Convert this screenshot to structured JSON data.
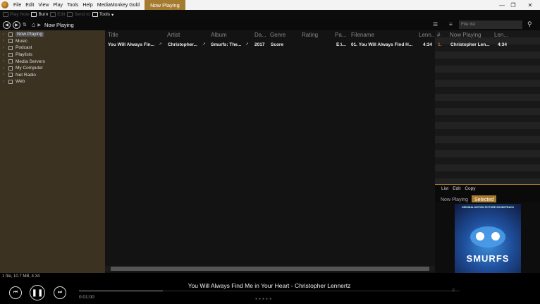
{
  "menu": [
    "File",
    "Edit",
    "View",
    "Play",
    "Tools",
    "Help",
    "MediaMonkey Gold"
  ],
  "tab_now_playing": "Now Playing",
  "toolbar": {
    "play_now": "Play Now",
    "burn": "Burn",
    "edit": "Edit",
    "send_to": "Send to",
    "tools": "Tools"
  },
  "nav": {
    "location": "Now Playing"
  },
  "file_list_placeholder": "File list",
  "tree": [
    {
      "label": "Now Playing",
      "active": true
    },
    {
      "label": "Music"
    },
    {
      "label": "Podcast"
    },
    {
      "label": "Playlists"
    },
    {
      "label": "Media Servers"
    },
    {
      "label": "My Computer"
    },
    {
      "label": "Net Radio"
    },
    {
      "label": "Web"
    }
  ],
  "columns": [
    "Title",
    "Artist",
    "Album",
    "Da...",
    "Genre",
    "Rating",
    "Pa...",
    "Filename",
    "Lenn..."
  ],
  "track": {
    "title": "You Will Always Fin...",
    "artist": "Christopher...",
    "album": "Smurfs: The...",
    "date": "2017",
    "genre": "Score",
    "path": "E:\\...",
    "filename": "01. You Will Always Find H...",
    "length": "4:34"
  },
  "right_panel": {
    "columns": [
      "#",
      "Now Playing",
      "Len..."
    ],
    "row": {
      "num": "1.",
      "artist": "Christopher Len...",
      "length": "4:34"
    },
    "list_menu": [
      "List",
      "Edit",
      "Copy"
    ],
    "tabs": [
      "Now Playing",
      "Selected"
    ],
    "art_caption": "ORIGINAL MOTION PICTURE SOUNDTRACK",
    "art_logo": "SMURFS"
  },
  "status": "1 file, 10.7 MB, 4:34",
  "player": {
    "now_playing": "You Will Always Find Me in Your Heart - Christopher Lennertz",
    "elapsed": "0:01:00",
    "progress": 0.22
  },
  "colors": {
    "accent": "#a57b2f",
    "tree_bg": "#3c3222"
  }
}
